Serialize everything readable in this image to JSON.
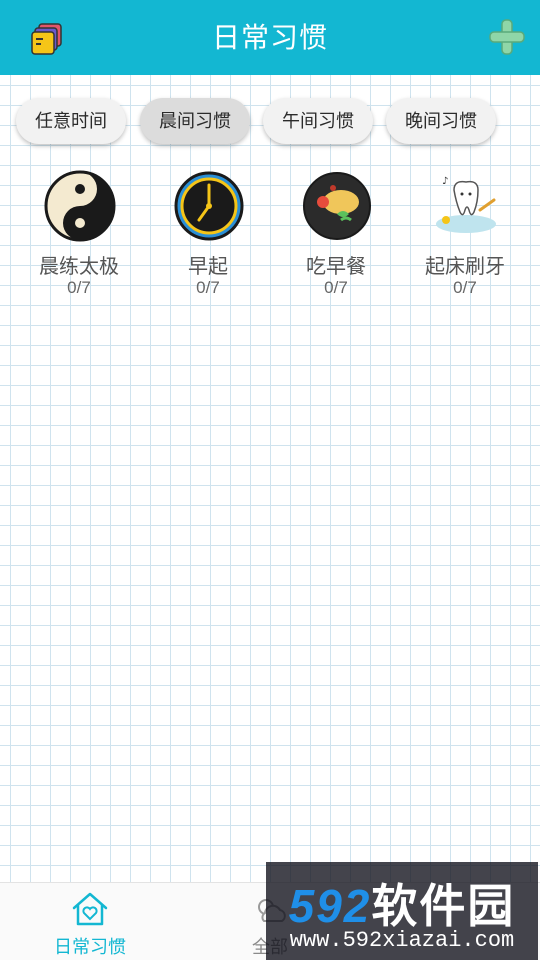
{
  "header": {
    "title": "日常习惯",
    "menu_icon": "notes-icon",
    "add_icon": "plus-icon",
    "brand_color": "#13b7d2"
  },
  "tabs": [
    {
      "label": "任意时间",
      "active": false
    },
    {
      "label": "晨间习惯",
      "active": true
    },
    {
      "label": "午间习惯",
      "active": false
    },
    {
      "label": "晚间习惯",
      "active": false
    }
  ],
  "habits": [
    {
      "name": "晨练太极",
      "count": "0/7",
      "icon": "yin-yang-icon"
    },
    {
      "name": "早起",
      "count": "0/7",
      "icon": "clock-icon"
    },
    {
      "name": "吃早餐",
      "count": "0/7",
      "icon": "breakfast-plate-icon"
    },
    {
      "name": "起床刷牙",
      "count": "0/7",
      "icon": "tooth-brushing-icon"
    }
  ],
  "bottom_nav": [
    {
      "label": "日常习惯",
      "icon": "home-heart-icon",
      "active": true
    },
    {
      "label": "全部",
      "icon": "weather-icon",
      "active": false
    }
  ],
  "watermark": {
    "logo_number": "592",
    "logo_text": "软件园",
    "url": "www.592xiazai.com"
  }
}
